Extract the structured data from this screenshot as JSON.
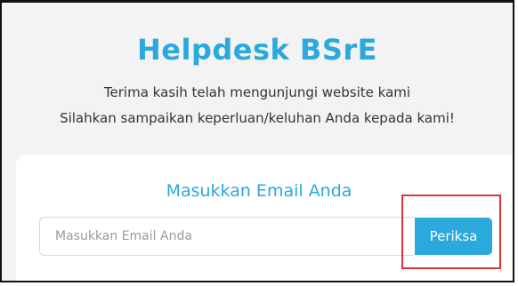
{
  "header": {
    "title": "Helpdesk BSrE",
    "subtitle_line1": "Terima kasih telah mengunjungi website kami",
    "subtitle_line2": "Silahkan sampaikan keperluan/keluhan Anda kepada kami!"
  },
  "email_form": {
    "heading": "Masukkan Email Anda",
    "input_value": "",
    "input_placeholder": "Masukkan Email Anda",
    "button_label": "Periksa"
  },
  "colors": {
    "accent": "#2ba9dd",
    "background": "#f3f3f3",
    "card": "#ffffff",
    "highlight": "#e23232"
  }
}
